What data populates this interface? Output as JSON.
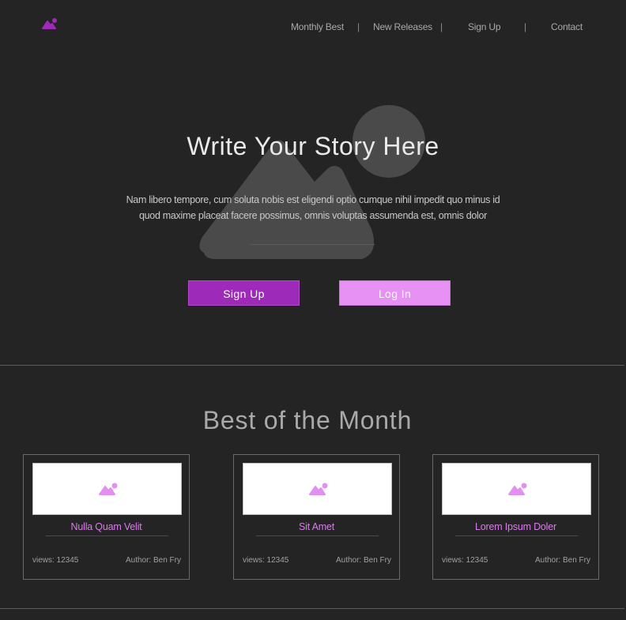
{
  "header": {
    "nav": [
      {
        "label": "Monthly Best"
      },
      {
        "label": "New Releases"
      },
      {
        "label": "Sign Up"
      },
      {
        "label": "Contact"
      }
    ],
    "separator": "|"
  },
  "hero": {
    "title": "Write Your Story Here",
    "text": "Nam libero tempore, cum soluta nobis est eligendi optio cumque nihil impedit quo minus id quod maxime placeat facere possimus, omnis voluptas assumenda est, omnis dolor",
    "signup_label": "Sign Up",
    "login_label": "Log In"
  },
  "best": {
    "title": "Best of the Month",
    "cards": [
      {
        "title": "Nulla Quam Velit",
        "views": "views: 12345",
        "author": "Author: Ben Fry"
      },
      {
        "title": "Sit Amet",
        "views": "views: 12345",
        "author": "Author: Ben Fry"
      },
      {
        "title": "Lorem Ipsum Doler",
        "views": "views: 12345",
        "author": "Author: Ben Fry"
      }
    ]
  },
  "colors": {
    "background": "#252425",
    "accent": "#9e2ab9",
    "accent_light": "#e791f5",
    "card_title": "#d77de8"
  },
  "icons": {
    "logo": "image-placeholder-icon",
    "card_image": "image-placeholder-icon"
  }
}
